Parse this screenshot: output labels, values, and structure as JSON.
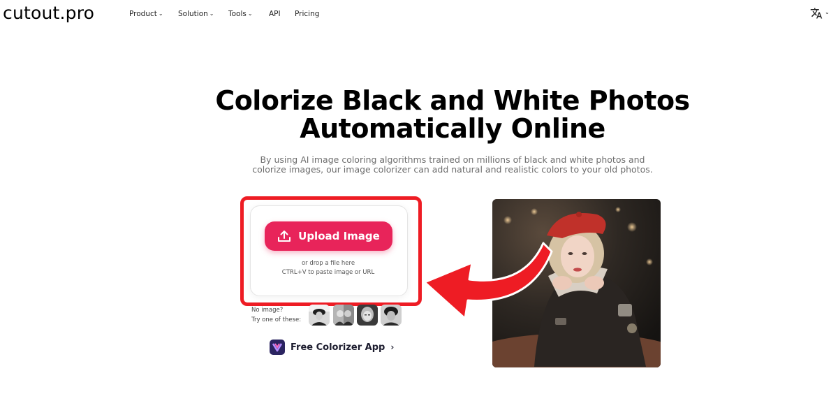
{
  "header": {
    "logo": "cutout.pro",
    "nav": [
      {
        "label": "Product",
        "has_dropdown": true
      },
      {
        "label": "Solution",
        "has_dropdown": true
      },
      {
        "label": "Tools",
        "has_dropdown": true
      },
      {
        "label": "API",
        "has_dropdown": false
      },
      {
        "label": "Pricing",
        "has_dropdown": false
      }
    ],
    "language_icon": "translate-icon"
  },
  "hero": {
    "title_line1": "Colorize Black and White Photos",
    "title_line2": "Automatically Online",
    "subtitle_line1": "By using AI image coloring algorithms trained on millions of black and white photos and",
    "subtitle_line2": "colorize images, our image colorizer can add natural and realistic colors to your old photos."
  },
  "upload": {
    "button_label": "Upload Image",
    "button_icon": "upload-icon",
    "drop_hint": "or drop a file here",
    "paste_hint": "CTRL+V to paste image or URL",
    "no_image_label": "No image?",
    "try_label": "Try one of these:",
    "sample_count": 4
  },
  "app": {
    "label": "Free Colorizer App",
    "chevron": "›"
  },
  "colors": {
    "accent": "#e8245a",
    "annotation_red": "#ee1c24",
    "app_icon_bg": "#2b2461"
  }
}
